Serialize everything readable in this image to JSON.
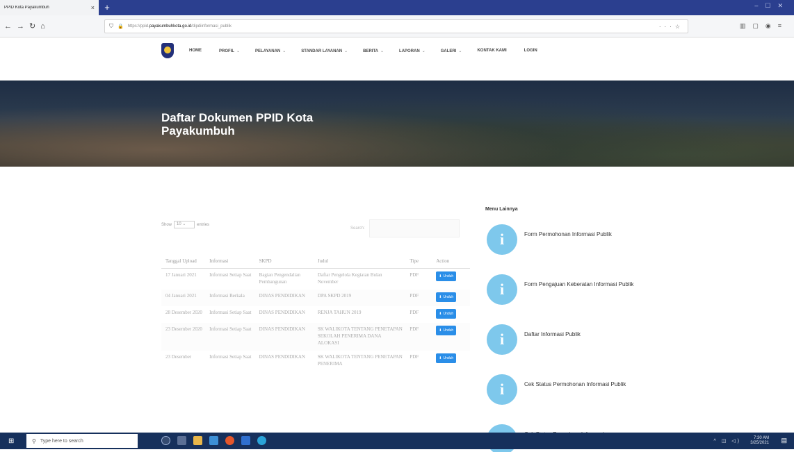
{
  "browser": {
    "tab_title": "PPID Kota Payakumbuh",
    "tab_close": "×",
    "new_tab": "+",
    "url_prefix": "https://ppid.",
    "url_domain": "payakumbuhkota.go.id",
    "url_path": "/dipdiinformasi_publik"
  },
  "nav": {
    "items": [
      {
        "label": "HOME",
        "caret": ""
      },
      {
        "label": "PROFIL",
        "caret": "⌄"
      },
      {
        "label": "PELAYANAN",
        "caret": "⌄"
      },
      {
        "label": "STANDAR LAYANAN",
        "caret": "⌄"
      },
      {
        "label": "BERITA",
        "caret": "⌄"
      },
      {
        "label": "LAPORAN",
        "caret": "⌄"
      },
      {
        "label": "GALERI",
        "caret": "⌄"
      },
      {
        "label": "KONTAK KAMI",
        "caret": ""
      },
      {
        "label": "LOGIN",
        "caret": ""
      }
    ]
  },
  "banner": {
    "title": "Daftar Dokumen PPID Kota Payakumbuh"
  },
  "table_controls": {
    "show_label": "Show",
    "entries_value": "10",
    "entries_label": "entries",
    "search_label": "Search:"
  },
  "table": {
    "headers": [
      "Tanggal Upload",
      "Informasi",
      "SKPD",
      "Judul",
      "Tipe",
      "Action"
    ],
    "rows": [
      {
        "date": "17 Januari 2021",
        "info": "Informasi Setiap Saat",
        "skpd": "Bagian Pengendalian Pembangunan",
        "judul": "Daftar Pengelola Kegiatan Bulan November",
        "tipe": "PDF",
        "action": "Unduh"
      },
      {
        "date": "04 Januari 2021",
        "info": "Informasi Berkala",
        "skpd": "DINAS PENDIDIKAN",
        "judul": "DPA SKPD 2019",
        "tipe": "PDF",
        "action": "Unduh"
      },
      {
        "date": "28 Desember 2020",
        "info": "Informasi Setiap Saat",
        "skpd": "DINAS PENDIDIKAN",
        "judul": "RENJA TAHUN 2019",
        "tipe": "PDF",
        "action": "Unduh"
      },
      {
        "date": "23 Desember 2020",
        "info": "Informasi Setiap Saat",
        "skpd": "DINAS PENDIDIKAN",
        "judul": "SK WALIKOTA TENTANG PENETAPAN SEKOLAH PENERIMA DANA ALOKASI",
        "tipe": "PDF",
        "action": "Unduh"
      },
      {
        "date": "23 Desember",
        "info": "Informasi Setiap Saat",
        "skpd": "DINAS PENDIDIKAN",
        "judul": "SK WALIKOTA TENTANG PENETAPAN PENERIMA",
        "tipe": "PDF",
        "action": "Unduh"
      }
    ]
  },
  "sidebar": {
    "heading": "Menu Lainnya",
    "items": [
      {
        "label": "Form Permohonan Informasi Publik"
      },
      {
        "label": "Form Pengajuan Keberatan Informasi Publik"
      },
      {
        "label": "Daftar Informasi Publik"
      },
      {
        "label": "Cek Status Permohonan Informasi Publik"
      },
      {
        "label": "Cek Status Pengajuan Informasi"
      }
    ]
  },
  "taskbar": {
    "search_placeholder": "Type here to search",
    "time": "7:30 AM",
    "date": "3/25/2021"
  },
  "colors": {
    "accent": "#2a8ee8",
    "info_circle": "#7ec8ec",
    "taskbar": "#16305c",
    "tabstrip": "#2b3f8f"
  },
  "icons": [
    "back-icon",
    "forward-icon",
    "reload-icon",
    "home-icon",
    "shield-icon",
    "lock-icon",
    "info-icon",
    "download-icon",
    "windows-icon",
    "search-icon"
  ]
}
